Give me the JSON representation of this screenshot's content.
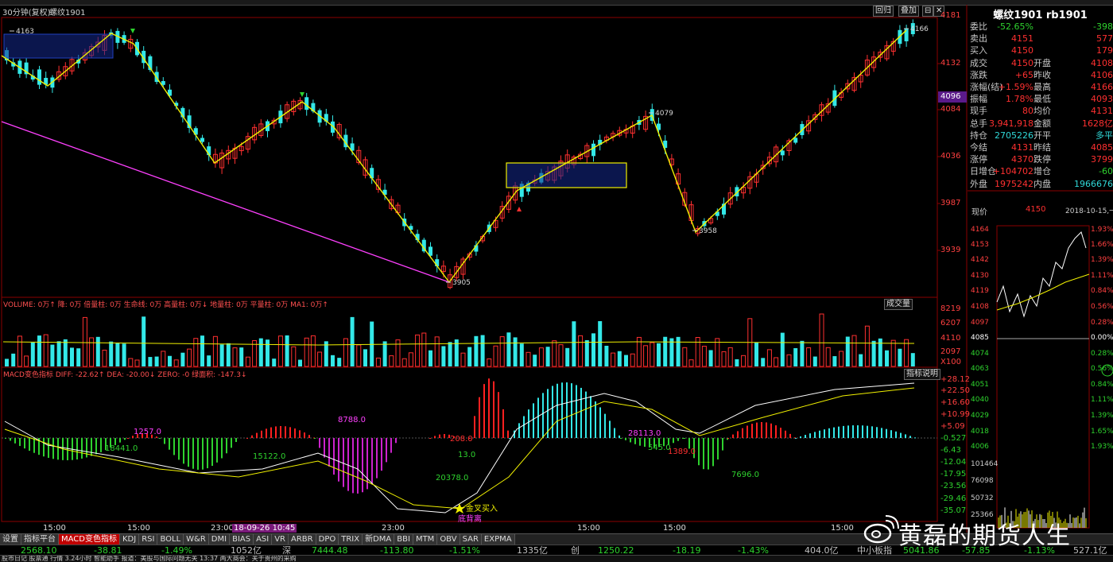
{
  "header": {
    "period": "30分钟(复权)",
    "symbol": "螺纹1901",
    "btn_restore": "回归",
    "btn_overlay": "叠加",
    "btn_minimize": "⊟",
    "btn_close": "✕"
  },
  "quote": {
    "title": "螺纹1901 rb1901",
    "rows": [
      {
        "k": "委比",
        "v": "-52.65%",
        "k2": "",
        "v2": "-398"
      },
      {
        "k": "卖出",
        "v": "4151",
        "k2": "",
        "v2": "577"
      },
      {
        "k": "买入",
        "v": "4150",
        "k2": "",
        "v2": "179"
      },
      {
        "k": "成交",
        "v": "4150",
        "k2": "开盘",
        "v2": "4108"
      },
      {
        "k": "涨跌",
        "v": "+65",
        "k2": "昨收",
        "v2": "4106"
      },
      {
        "k": "涨幅(结)",
        "v": "+1.59%",
        "k2": "最高",
        "v2": "4166"
      },
      {
        "k": "振幅",
        "v": "1.78%",
        "k2": "最低",
        "v2": "4093"
      },
      {
        "k": "现手",
        "v": "80",
        "k2": "均价",
        "v2": "4131"
      },
      {
        "k": "总手",
        "v": "3,941,918",
        "k2": "金额",
        "v2": "1628亿"
      },
      {
        "k": "持仓",
        "v": "2705226",
        "k2": "开平",
        "v2": "多平"
      },
      {
        "k": "今结",
        "v": "4131",
        "k2": "昨结",
        "v2": "4085"
      },
      {
        "k": "涨停",
        "v": "4370",
        "k2": "跌停",
        "v2": "3799"
      },
      {
        "k": "日增仓",
        "v": "+104702",
        "k2": "增仓",
        "v2": "-60"
      },
      {
        "k": "外盘",
        "v": "1975242",
        "k2": "内盘",
        "v2": "1966676"
      }
    ],
    "now_label": "现价",
    "now_value": "4150",
    "now_date": "2018-10-15,一"
  },
  "main_axis": [
    "4181",
    "4132",
    "4084",
    "4036",
    "3987",
    "3939"
  ],
  "main_axis_highlight": "4096",
  "annotations": {
    "p4163": "4163",
    "p4166": "4166",
    "p4079": "4079",
    "p3958": "3958",
    "p3905": "3905"
  },
  "volume": {
    "legend": "VOLUME: 0万↑ 降: 0万 倍量柱: 0万 生命线: 0万 高量柱: 0万↓ 地量柱: 0万 平量柱: 0万 MA1: 0万↑",
    "dropdown": "成交量",
    "axis": [
      "8219",
      "6207",
      "4110",
      "2097",
      "X100"
    ]
  },
  "macd": {
    "legend": "MACD变色指标 DIFF: -22.62↑ DEA: -20.00↓ ZERO: -0 绿面积: -147.3↓",
    "btn": "指标说明",
    "axis": [
      "+28.12",
      "+22.50",
      "+16.60",
      "+10.99",
      "+5.09",
      "-0.527",
      "-6.43",
      "-12.04",
      "-17.95",
      "-23.56",
      "-29.46",
      "-35.07"
    ],
    "labels": [
      {
        "t": "1257.0"
      },
      {
        "t": "18441.0"
      },
      {
        "t": "15122.0"
      },
      {
        "t": "8788.0"
      },
      {
        "t": "208.0"
      },
      {
        "t": "13.0"
      },
      {
        "t": "20378.0"
      },
      {
        "t": "28113.0"
      },
      {
        "t": "1389.0"
      },
      {
        "t": "545.0"
      },
      {
        "t": "7696.0"
      }
    ],
    "golden_cross": "金叉买入",
    "divergence": "底背离"
  },
  "time_axis": [
    "15:00",
    "15:00",
    "23:00",
    "18-09-26 10:45",
    "23:00",
    "15:00",
    "15:00",
    "15:00"
  ],
  "mini": {
    "axis_left": [
      "4164",
      "4153",
      "4142",
      "4130",
      "4119",
      "4108",
      "4097",
      "4085",
      "4074",
      "4063",
      "4051",
      "4040",
      "4029",
      "4018",
      "4006",
      "101464",
      "76098",
      "50732",
      "25366"
    ],
    "axis_right": [
      "1.93%",
      "1.66%",
      "1.39%",
      "1.11%",
      "0.84%",
      "0.56%",
      "0.28%",
      "0.00%",
      "0.28%",
      "0.56%",
      "0.84%",
      "1.11%",
      "1.39%",
      "1.65%",
      "1.93%"
    ]
  },
  "tabs": [
    "设置",
    "指标平台",
    "MACD变色指标",
    "KDJ",
    "RSI",
    "BOLL",
    "W&R",
    "DMI",
    "BIAS",
    "ASI",
    "VR",
    "ARBR",
    "DPO",
    "TRIX",
    "新DMA",
    "BBI",
    "MTM",
    "OBV",
    "SAR",
    "EXPMA"
  ],
  "ticker": [
    {
      "t": "2568.10",
      "c": "#2ed22e"
    },
    {
      "t": "-38.81",
      "c": "#2ed22e"
    },
    {
      "t": "-1.49%",
      "c": "#2ed22e"
    },
    {
      "t": "1052亿",
      "c": "#c0c0c0"
    },
    {
      "t": "深",
      "c": "#c0c0c0"
    },
    {
      "t": "7444.48",
      "c": "#2ed22e"
    },
    {
      "t": "-113.80",
      "c": "#2ed22e"
    },
    {
      "t": "-1.51%",
      "c": "#2ed22e"
    },
    {
      "t": "1335亿",
      "c": "#c0c0c0"
    },
    {
      "t": "创",
      "c": "#c0c0c0"
    },
    {
      "t": "1250.22",
      "c": "#2ed22e"
    },
    {
      "t": "-18.19",
      "c": "#2ed22e"
    },
    {
      "t": "-1.43%",
      "c": "#2ed22e"
    },
    {
      "t": "404.0亿",
      "c": "#c0c0c0"
    },
    {
      "t": "中小板指",
      "c": "#c0c0c0"
    },
    {
      "t": "5041.86",
      "c": "#2ed22e"
    },
    {
      "t": "-57.85",
      "c": "#2ed22e"
    },
    {
      "t": "-1.13%",
      "c": "#2ed22e"
    },
    {
      "t": "527.1亿",
      "c": "#c0c0c0"
    }
  ],
  "status": "股市日记  股票通  行情  3.24小时  智能助手  报道：美股与国际问题无关  13:37  两大商会：关于贵州的采购",
  "watermark": "黄磊的期货人生",
  "colors": {
    "up": "#ff3030",
    "down": "#33e8e8",
    "yellow": "#f0f000",
    "magenta": "#ff40ff",
    "green": "#2ed22e",
    "navy": "#0a1a5a"
  }
}
